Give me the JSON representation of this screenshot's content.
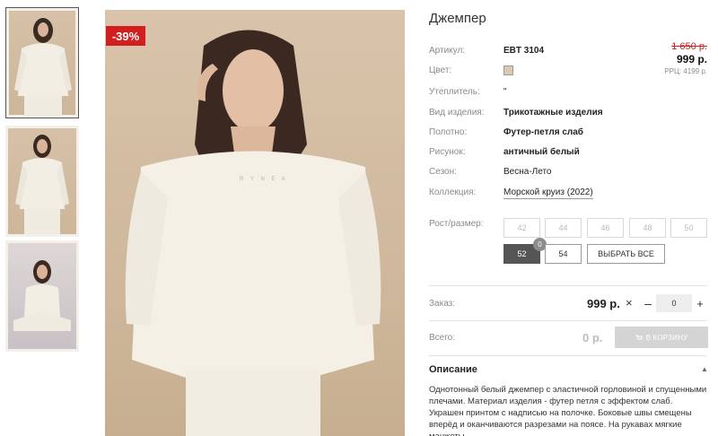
{
  "product": {
    "title": "Джемпер",
    "discount": "-39%",
    "old_price": "1 650 р.",
    "new_price": "999 р.",
    "rrp": "РРЦ: 4199 р.",
    "color_hex": "#d8c9b0"
  },
  "specs": [
    {
      "label": "Артикул:",
      "value": "EBT 3104"
    },
    {
      "label": "Цвет:",
      "value": ""
    },
    {
      "label": "Утеплитель:",
      "value": "\""
    },
    {
      "label": "Вид изделия:",
      "value": "Трикотажные изделия"
    },
    {
      "label": "Полотно:",
      "value": "Футер-петля слаб"
    },
    {
      "label": "Рисунок:",
      "value": "античный белый"
    },
    {
      "label": "Сезон:",
      "value": "Весна-Лето"
    },
    {
      "label": "Коллекция:",
      "value": "Морской круиз (2022)"
    }
  ],
  "sizes": {
    "label": "Рост/размер:",
    "row1": [
      "42",
      "44",
      "46",
      "48",
      "50"
    ],
    "row2": [
      "52",
      "54"
    ],
    "selected": "52",
    "selected_count": "0",
    "select_all": "ВЫБРАТЬ ВСЕ"
  },
  "order": {
    "label": "Заказ:",
    "price": "999 р.",
    "times": "×",
    "minus": "–",
    "quantity": "0",
    "plus": "+"
  },
  "total": {
    "label": "Всего:",
    "value": "0 р.",
    "cart_button": "В КОРЗИНУ"
  },
  "description": {
    "title": "Описание",
    "text": "Однотонный белый джемпер с эластичной горловиной и спущенными плечами. Материал изделия - футер петля с эффектом слаб. Украшен принтом с надписью на полочке. Боковые швы смещены вперёд и оканчиваются разрезами на поясе. На рукавах мягкие манжеты."
  },
  "colors": {
    "badge": "#d11f1f",
    "old_price": "#d11f1f",
    "selected_size": "#555555",
    "cart_button": "#d4d4d4"
  }
}
